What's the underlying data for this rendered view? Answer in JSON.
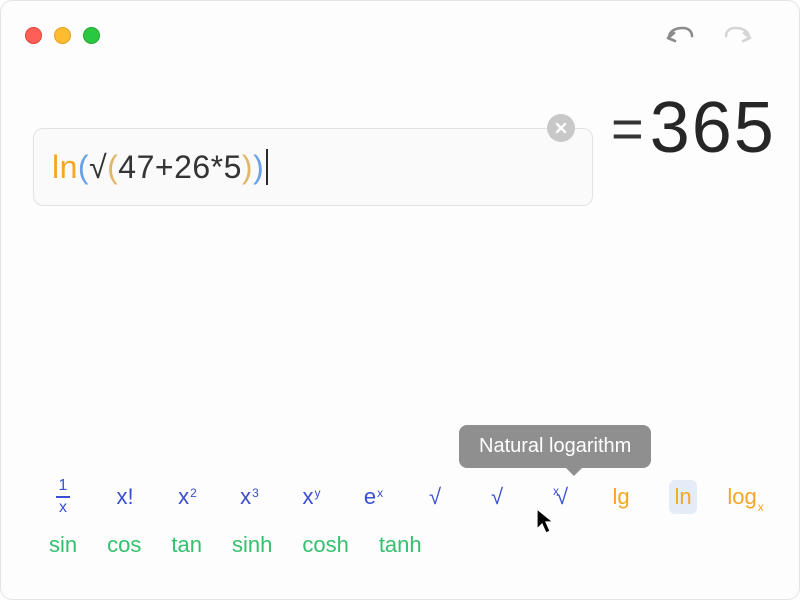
{
  "expression": {
    "raw": "ln(√(47+26*5))",
    "tokens": {
      "ln": "ln",
      "p1": "(",
      "sqrt": "√",
      "p2": "(",
      "inner": "47+26*5",
      "p2c": ")",
      "p1c": ")"
    }
  },
  "result": "365",
  "equals": "=",
  "tooltip": "Natural logarithm",
  "functions": {
    "row1": {
      "recip": {
        "num": "1",
        "den": "x"
      },
      "fact": "x!",
      "sq_base": "x",
      "sq_exp": "2",
      "cube_base": "x",
      "cube_exp": "3",
      "pow_base": "x",
      "pow_exp": "y",
      "exp_base": "e",
      "exp_exp": "x",
      "sqrt": "√",
      "sqrt2": "√",
      "nroot_exp": "x",
      "nroot_sym": "√",
      "lg": "lg",
      "ln": "ln",
      "log_base": "log",
      "log_sub": "x"
    },
    "row2": {
      "sin": "sin",
      "cos": "cos",
      "tan": "tan",
      "sinh": "sinh",
      "cosh": "cosh",
      "tanh": "tanh"
    }
  }
}
